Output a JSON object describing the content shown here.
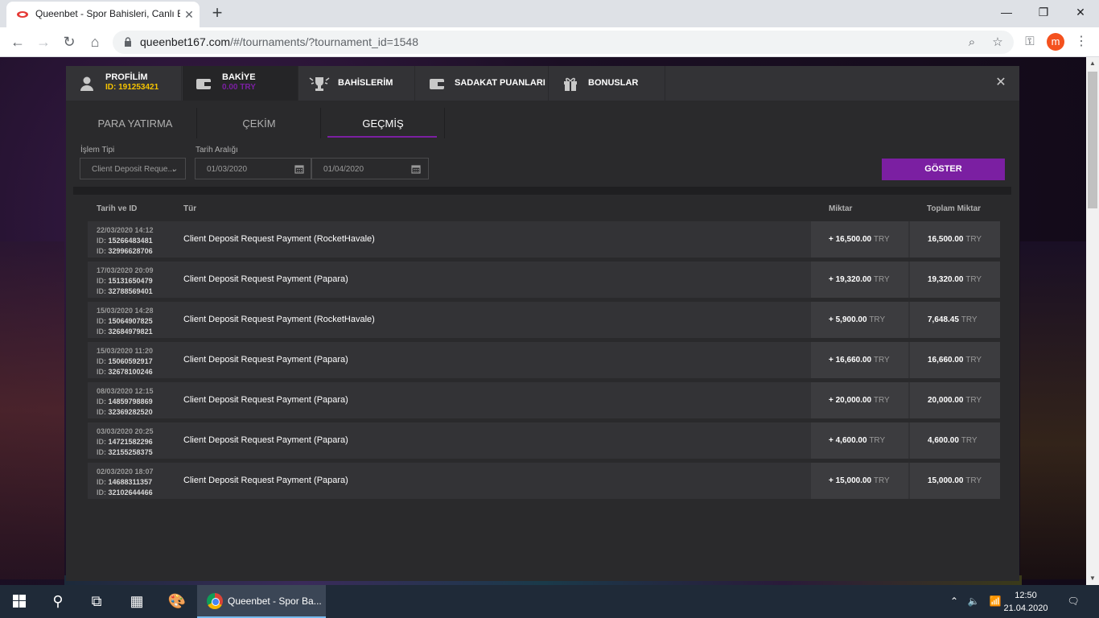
{
  "browser": {
    "tab_title": "Queenbet - Spor Bahisleri, Canlı B",
    "url_main": "queenbet167.com",
    "url_path": "/#/tournaments/?tournament_id=1548",
    "avatar_letter": "m"
  },
  "modal": {
    "tabs": [
      {
        "label": "PROFİLİM",
        "sub": "ID: 191253421",
        "icon": "user-icon"
      },
      {
        "label": "BAKİYE",
        "sub": "0.00 TRY",
        "icon": "wallet-icon"
      },
      {
        "label": "BAHİSLERİM",
        "icon": "trophy-icon"
      },
      {
        "label": "SADAKAT PUANLARI",
        "icon": "card-icon"
      },
      {
        "label": "BONUSLAR",
        "icon": "gift-icon"
      }
    ],
    "subtabs": [
      "PARA YATIRMA",
      "ÇEKİM",
      "GEÇMİŞ"
    ],
    "active_subtab": "GEÇMİŞ",
    "filters": {
      "type_label": "İşlem Tipi",
      "type_value": "Client Deposit Reque...",
      "date_label": "Tarih Aralığı",
      "date_from": "01/03/2020",
      "date_to": "01/04/2020",
      "show_button": "GÖSTER"
    },
    "table": {
      "headers": {
        "date": "Tarih ve ID",
        "type": "Tür",
        "amount": "Miktar",
        "total": "Toplam Miktar"
      },
      "id_prefix": "ID:",
      "currency": "TRY",
      "rows": [
        {
          "date": "22/03/2020 14:12",
          "id1": "15266483481",
          "id2": "32996628706",
          "type": "Client Deposit Request Payment (RocketHavale)",
          "amount": "+ 16,500.00",
          "total": "16,500.00"
        },
        {
          "date": "17/03/2020 20:09",
          "id1": "15131650479",
          "id2": "32788569401",
          "type": "Client Deposit Request Payment (Papara)",
          "amount": "+ 19,320.00",
          "total": "19,320.00"
        },
        {
          "date": "15/03/2020 14:28",
          "id1": "15064907825",
          "id2": "32684979821",
          "type": "Client Deposit Request Payment (RocketHavale)",
          "amount": "+ 5,900.00",
          "total": "7,648.45"
        },
        {
          "date": "15/03/2020 11:20",
          "id1": "15060592917",
          "id2": "32678100246",
          "type": "Client Deposit Request Payment (Papara)",
          "amount": "+ 16,660.00",
          "total": "16,660.00"
        },
        {
          "date": "08/03/2020 12:15",
          "id1": "14859798869",
          "id2": "32369282520",
          "type": "Client Deposit Request Payment (Papara)",
          "amount": "+ 20,000.00",
          "total": "20,000.00"
        },
        {
          "date": "03/03/2020 20:25",
          "id1": "14721582296",
          "id2": "32155258375",
          "type": "Client Deposit Request Payment (Papara)",
          "amount": "+ 4,600.00",
          "total": "4,600.00"
        },
        {
          "date": "02/03/2020 18:07",
          "id1": "14688311357",
          "id2": "32102644466",
          "type": "Client Deposit Request Payment (Papara)",
          "amount": "+ 15,000.00",
          "total": "15,000.00"
        }
      ]
    }
  },
  "taskbar": {
    "chrome_label": "Queenbet - Spor Ba...",
    "time": "12:50",
    "date": "21.04.2020"
  },
  "colors": {
    "accent": "#7b1fa2",
    "id_yellow": "#f5c400"
  }
}
